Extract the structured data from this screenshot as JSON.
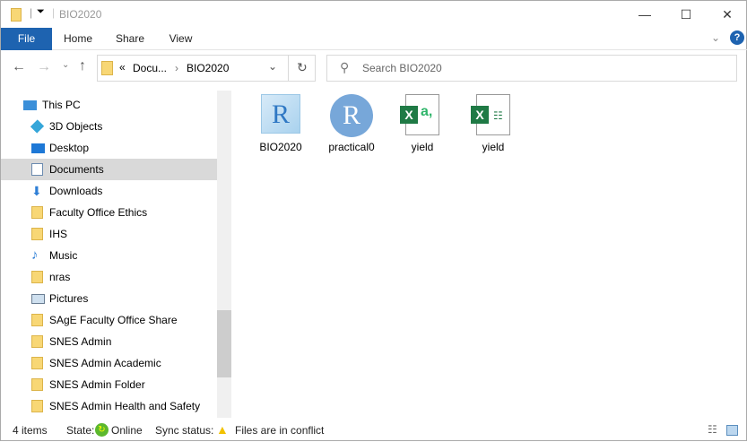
{
  "window": {
    "title": "BIO2020",
    "minimize": "—",
    "maximize": "☐",
    "close": "✕"
  },
  "ribbon": {
    "tabs": [
      "File",
      "Home",
      "Share",
      "View"
    ],
    "help": "?"
  },
  "address": {
    "overflow": "«",
    "crumbs": [
      "Docu...",
      "BIO2020"
    ],
    "search_placeholder": "Search BIO2020"
  },
  "nav": {
    "items": [
      {
        "label": "This PC",
        "icon": "pc-icon"
      },
      {
        "label": "3D Objects",
        "icon": "3d-objects-icon"
      },
      {
        "label": "Desktop",
        "icon": "desktop-icon"
      },
      {
        "label": "Documents",
        "icon": "documents-icon",
        "selected": true
      },
      {
        "label": "Downloads",
        "icon": "downloads-icon"
      },
      {
        "label": "Faculty Office Ethics",
        "icon": "network-folder-icon"
      },
      {
        "label": "IHS",
        "icon": "network-folder-icon"
      },
      {
        "label": "Music",
        "icon": "music-icon"
      },
      {
        "label": "nras",
        "icon": "folder-icon"
      },
      {
        "label": "Pictures",
        "icon": "pictures-icon"
      },
      {
        "label": "SAgE Faculty Office Share",
        "icon": "network-folder-icon"
      },
      {
        "label": "SNES Admin",
        "icon": "network-folder-icon"
      },
      {
        "label": "SNES Admin Academic",
        "icon": "network-folder-icon"
      },
      {
        "label": "SNES Admin Folder",
        "icon": "network-folder-icon"
      },
      {
        "label": "SNES Admin Health and Safety",
        "icon": "network-folder-icon"
      }
    ]
  },
  "files": [
    {
      "name": "BIO2020",
      "icon": "rproject-icon"
    },
    {
      "name": "practical0",
      "icon": "r-script-icon"
    },
    {
      "name": "yield",
      "icon": "excel-csv-icon"
    },
    {
      "name": "yield",
      "icon": "excel-workbook-icon"
    }
  ],
  "status": {
    "count": "4 items",
    "state_label": "State:",
    "state": "Online",
    "sync_label": "Sync status:",
    "sync": "Files are in conflict"
  }
}
